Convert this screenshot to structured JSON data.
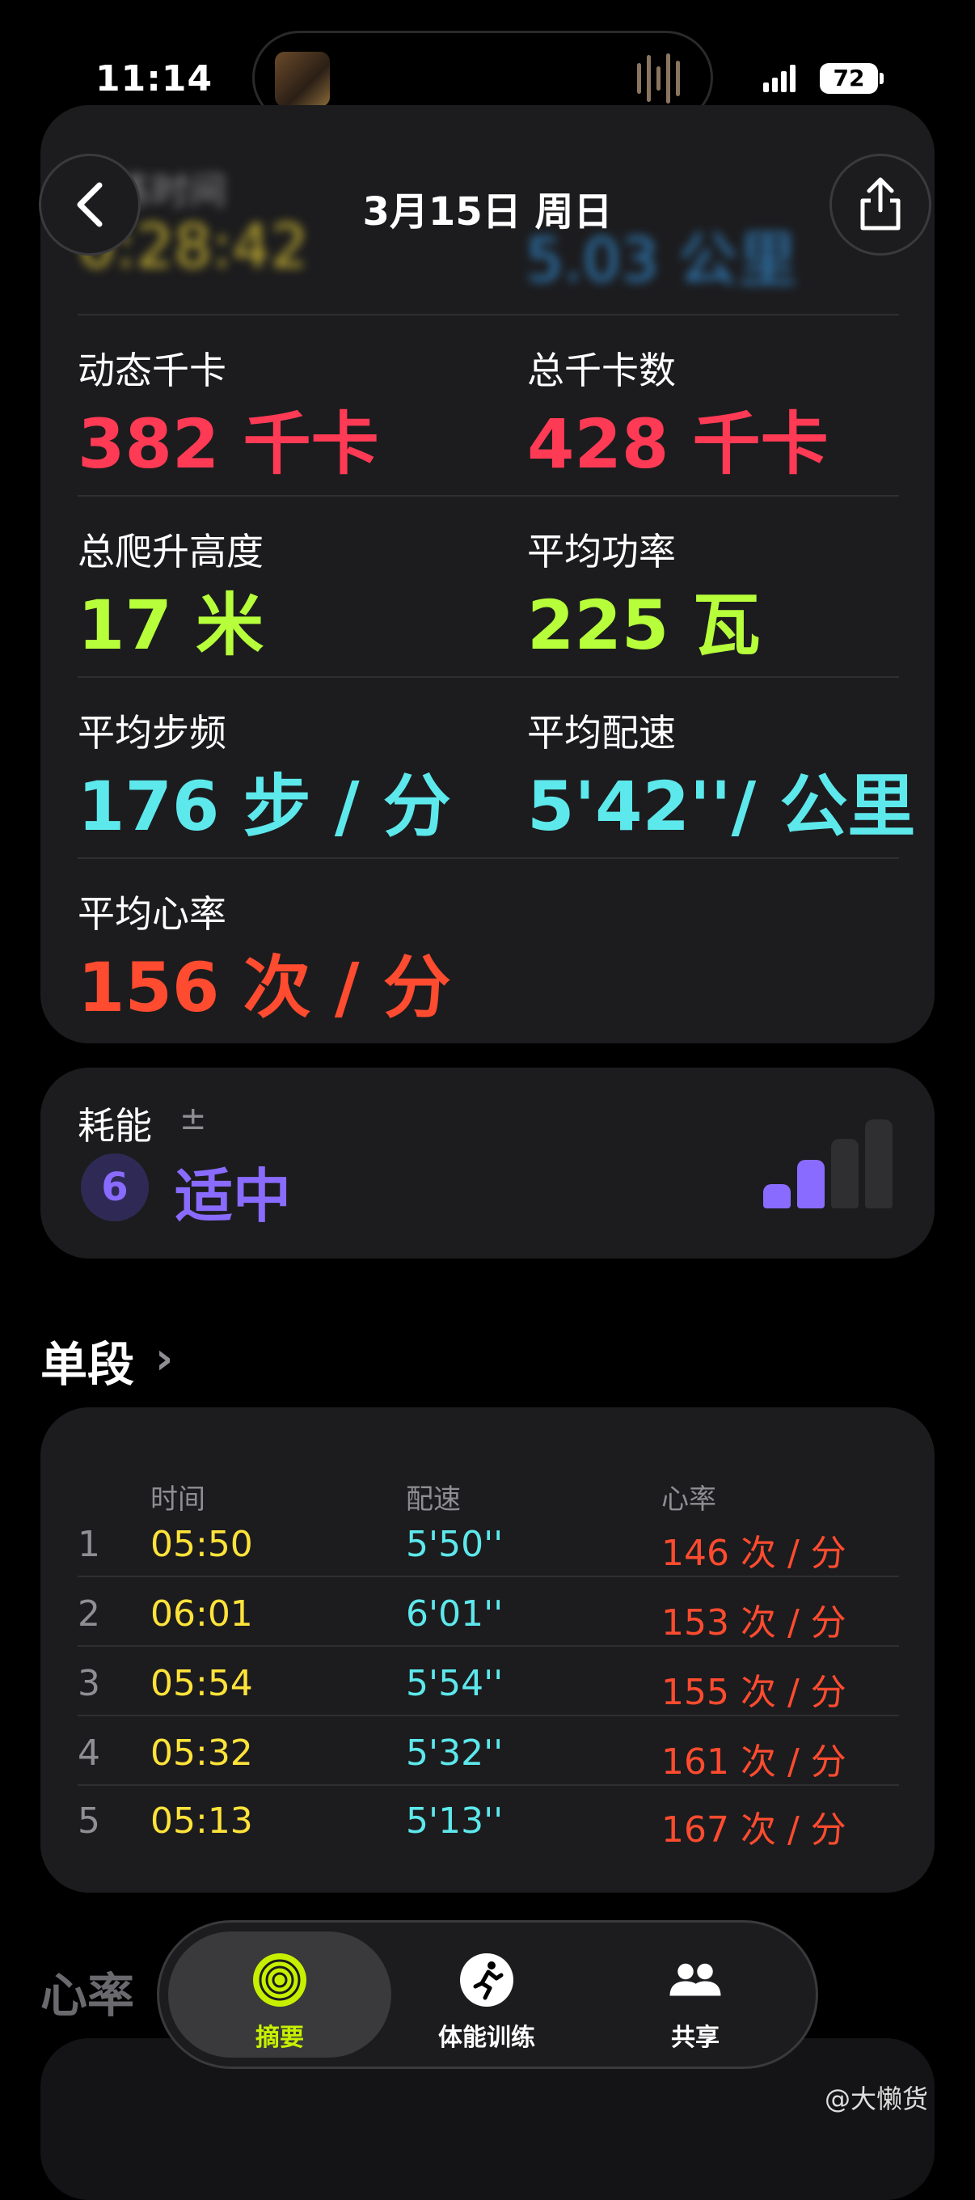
{
  "status_bar": {
    "time": "11:14",
    "battery": "72"
  },
  "header": {
    "title": "3月15日 周日"
  },
  "blurred_top": {
    "left_value": "0:28:42",
    "right_value": "5.03 公里",
    "left_label": "训练时间"
  },
  "stats": [
    {
      "label": "动态千卡",
      "value": "382 千卡",
      "color": "#ff3a55"
    },
    {
      "label": "总千卡数",
      "value": "428 千卡",
      "color": "#ff3a55"
    },
    {
      "label": "总爬升高度",
      "value": "17 米",
      "color": "#b6ff3a"
    },
    {
      "label": "平均功率",
      "value": "225 瓦",
      "color": "#b6ff3a"
    },
    {
      "label": "平均步频",
      "value": "176 步 / 分",
      "color": "#5de8ec"
    },
    {
      "label": "平均配速",
      "value": "5'42''/ 公里",
      "color": "#5de8ec"
    },
    {
      "label": "平均心率",
      "value": "156 次 / 分",
      "color": "#ff4b2f"
    }
  ],
  "effort": {
    "label": "耗能",
    "plus_minus": "±",
    "score": "6",
    "level": "适中",
    "level_fraction": 0.6
  },
  "splits": {
    "title": "单段",
    "headers": {
      "time": "时间",
      "pace": "配速",
      "heart_rate": "心率"
    },
    "rows": [
      {
        "n": "1",
        "time": "05:50",
        "pace": "5'50''",
        "hr": "146 次 / 分"
      },
      {
        "n": "2",
        "time": "06:01",
        "pace": "6'01''",
        "hr": "153 次 / 分"
      },
      {
        "n": "3",
        "time": "05:54",
        "pace": "5'54''",
        "hr": "155 次 / 分"
      },
      {
        "n": "4",
        "time": "05:32",
        "pace": "5'32''",
        "hr": "161 次 / 分"
      },
      {
        "n": "5",
        "time": "05:13",
        "pace": "5'13''",
        "hr": "167 次 / 分"
      }
    ]
  },
  "heart_rate_section": {
    "title": "心率"
  },
  "tabbar": {
    "tabs": [
      {
        "label": "摘要",
        "icon": "summary-rings-icon",
        "active": true
      },
      {
        "label": "体能训练",
        "icon": "running-figure-icon",
        "active": false
      },
      {
        "label": "共享",
        "icon": "people-icon",
        "active": false
      }
    ]
  },
  "watermark": "@大懒货",
  "colors": {
    "yellow": "#ffe33a",
    "cyan": "#5de8ec",
    "red": "#ff3a55",
    "hr": "#ff4b2f",
    "green": "#b6ff3a",
    "purple": "#8a6bff"
  }
}
